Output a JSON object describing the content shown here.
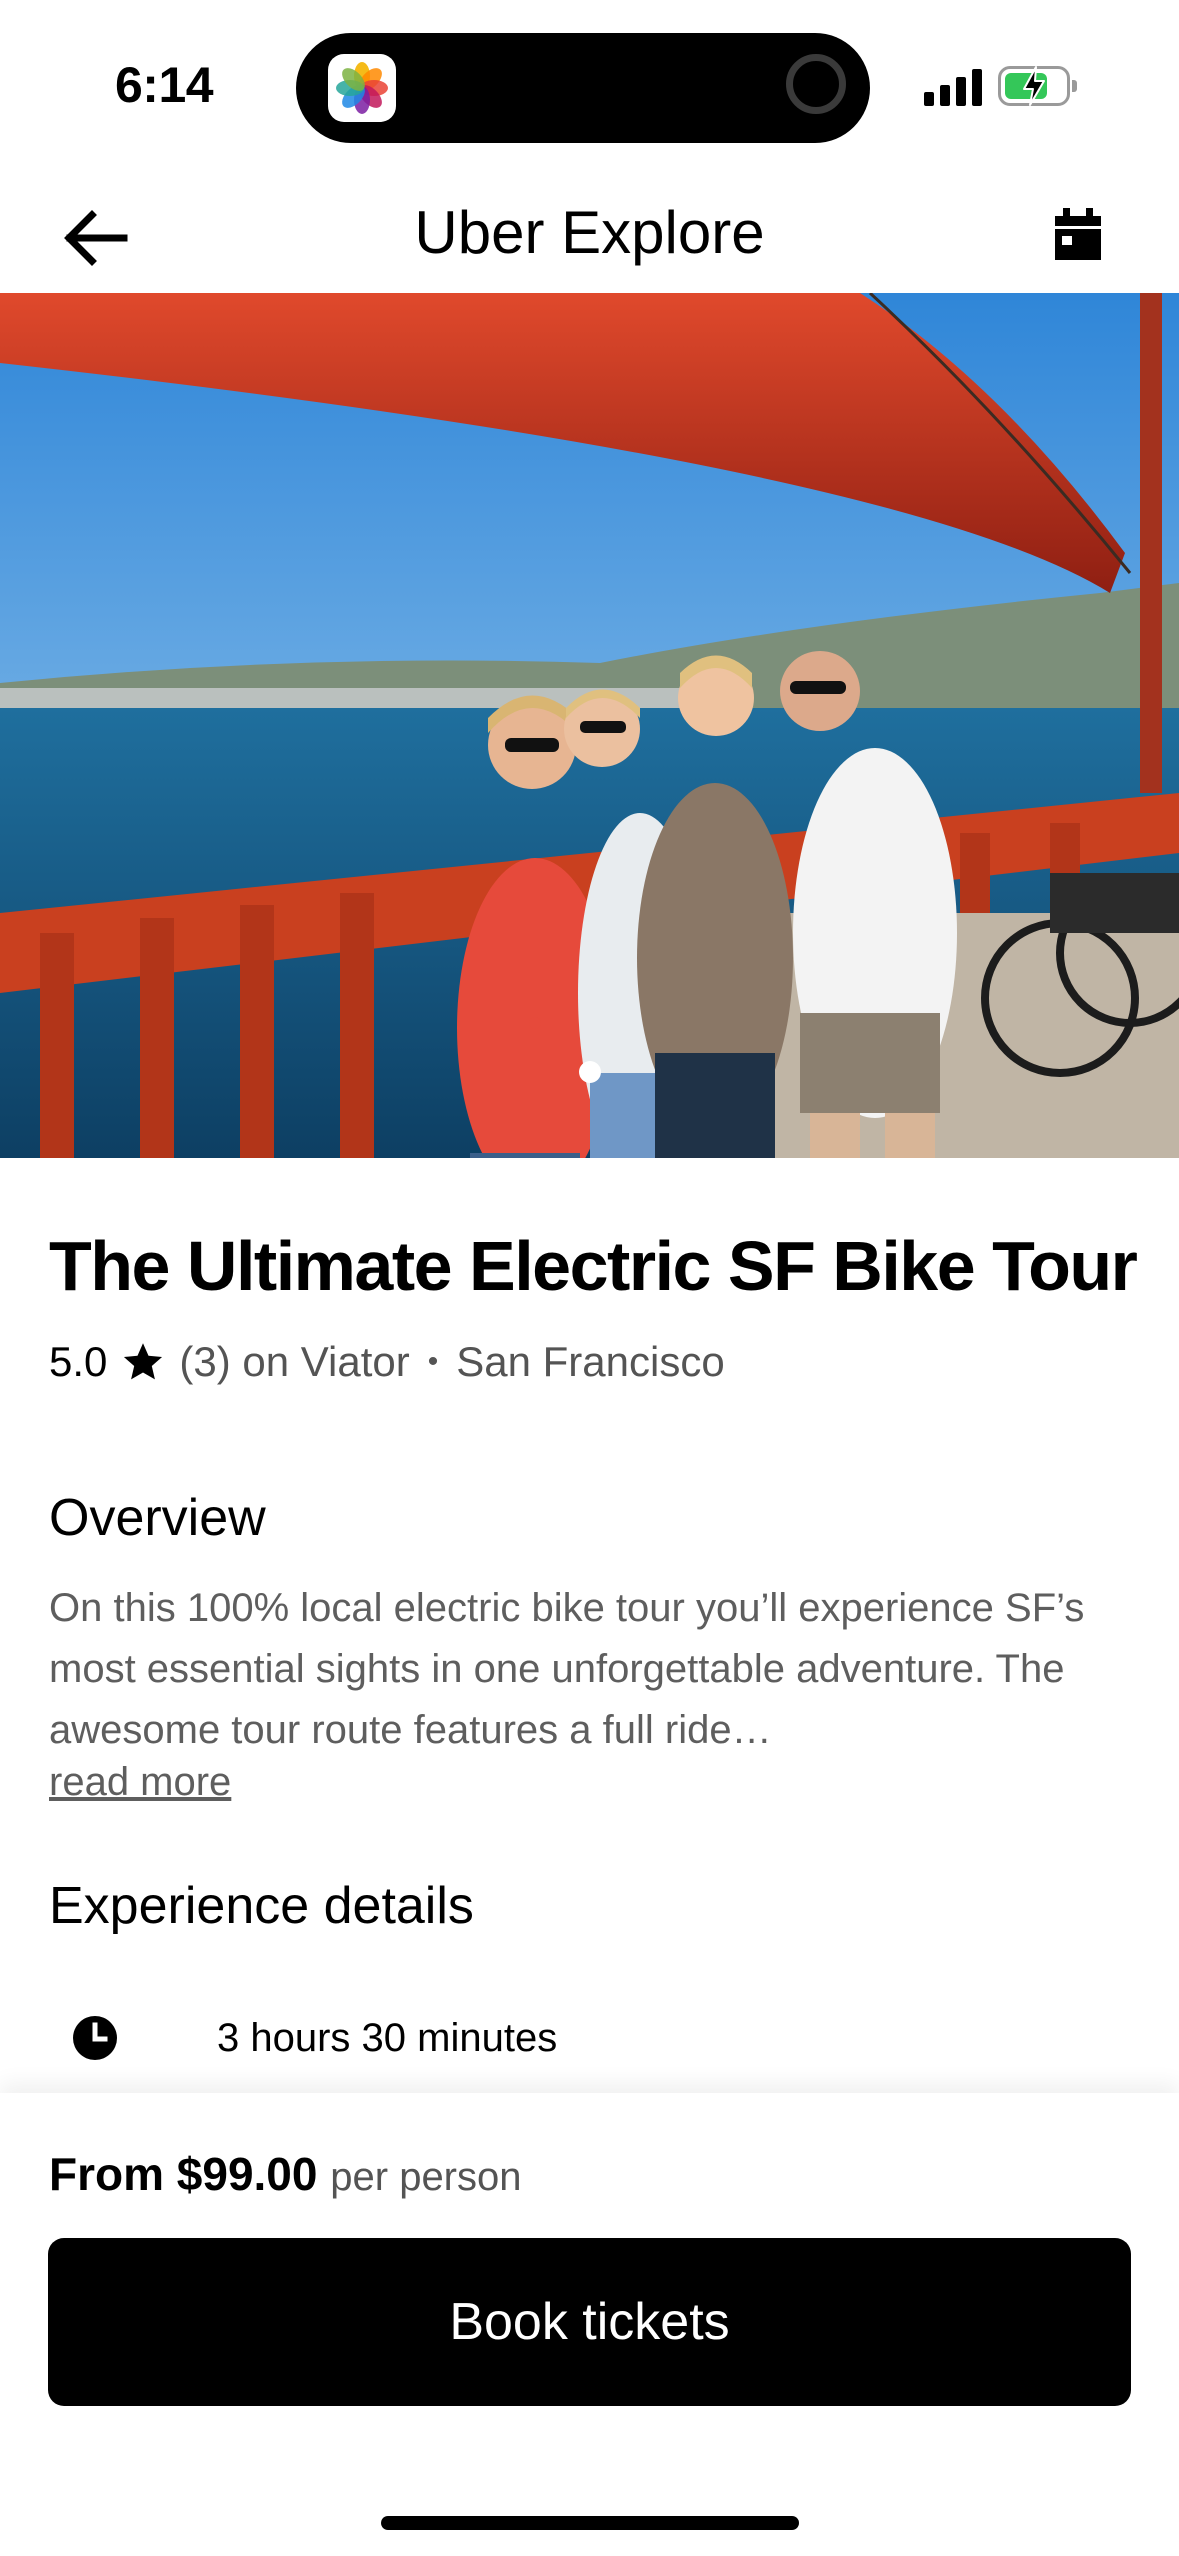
{
  "status_bar": {
    "time": "6:14",
    "island_app_icon": "photos-app-icon",
    "battery_charging": true,
    "battery_level": 0.6,
    "signal_bars": 4
  },
  "nav": {
    "title": "Uber Explore",
    "back_icon": "arrow-left-icon",
    "calendar_icon": "calendar-icon"
  },
  "hero": {
    "image_alt": "Four people posing on the Golden Gate Bridge with bikes",
    "carousel_total": 1,
    "carousel_index": 1
  },
  "experience": {
    "title": "The Ultimate Electric SF Bike Tour",
    "rating": "5.0",
    "reviews": "(3) on Viator",
    "separator": "•",
    "location": "San Francisco"
  },
  "overview": {
    "heading": "Overview",
    "text": "On this 100% local electric bike tour you’ll experience SF’s most essential sights in one unforgettable adventure. The awesome tour route features a full ride…",
    "read_more": "read more"
  },
  "details": {
    "heading": "Experience details",
    "duration": "3 hours 30 minutes"
  },
  "booking": {
    "price_prefix": "From",
    "price": "$99.00",
    "price_unit": "per person",
    "button_label": "Book tickets"
  },
  "colors": {
    "primary": "#000000",
    "muted_text": "#5e5e5e",
    "bridge_red": "#c0391f",
    "sky": "#5aa7e6"
  }
}
